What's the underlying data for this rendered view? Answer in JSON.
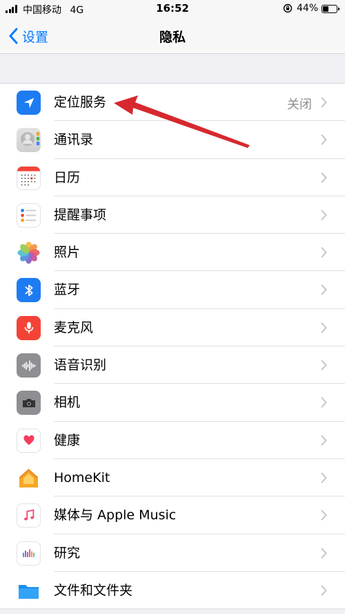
{
  "status_bar": {
    "carrier": "中国移动",
    "network": "4G",
    "time": "16:52",
    "battery": "44%"
  },
  "nav": {
    "back_label": "设置",
    "title": "隐私"
  },
  "items": [
    {
      "label": "定位服务",
      "detail": "关闭",
      "icon": "location-arrow-icon"
    },
    {
      "label": "通讯录",
      "detail": "",
      "icon": "contacts-icon"
    },
    {
      "label": "日历",
      "detail": "",
      "icon": "calendar-icon"
    },
    {
      "label": "提醒事项",
      "detail": "",
      "icon": "reminders-icon"
    },
    {
      "label": "照片",
      "detail": "",
      "icon": "photos-icon"
    },
    {
      "label": "蓝牙",
      "detail": "",
      "icon": "bluetooth-icon"
    },
    {
      "label": "麦克风",
      "detail": "",
      "icon": "microphone-icon"
    },
    {
      "label": "语音识别",
      "detail": "",
      "icon": "speech-recognition-icon"
    },
    {
      "label": "相机",
      "detail": "",
      "icon": "camera-icon"
    },
    {
      "label": "健康",
      "detail": "",
      "icon": "health-icon"
    },
    {
      "label": "HomeKit",
      "detail": "",
      "icon": "homekit-icon"
    },
    {
      "label": "媒体与 Apple Music",
      "detail": "",
      "icon": "music-icon"
    },
    {
      "label": "研究",
      "detail": "",
      "icon": "research-icon"
    },
    {
      "label": "文件和文件夹",
      "detail": "",
      "icon": "folder-icon"
    }
  ],
  "colors": {
    "accent": "#007aff",
    "annotation_arrow": "#d7282f"
  }
}
